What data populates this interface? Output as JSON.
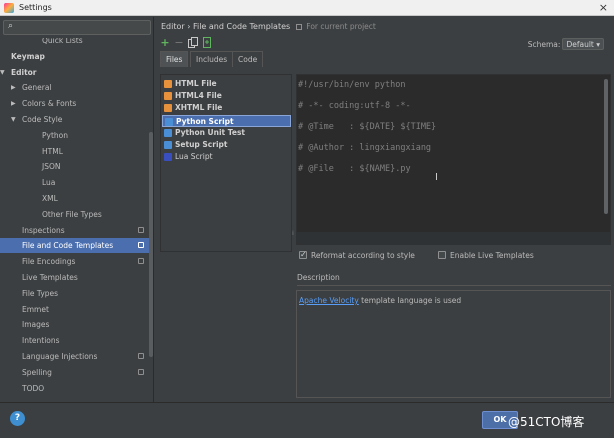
{
  "window": {
    "title": "Settings"
  },
  "sidebar": {
    "search_value": "",
    "items": [
      {
        "label": "Quick Lists",
        "level": 2
      },
      {
        "label": "Keymap",
        "level": 0,
        "bold": true
      },
      {
        "label": "Editor",
        "level": 0,
        "bold": true,
        "expanded": true
      },
      {
        "label": "General",
        "level": 1,
        "arrow": "right"
      },
      {
        "label": "Colors & Fonts",
        "level": 1,
        "arrow": "right"
      },
      {
        "label": "Code Style",
        "level": 1,
        "arrow": "down"
      },
      {
        "label": "Python",
        "level": 2
      },
      {
        "label": "HTML",
        "level": 2
      },
      {
        "label": "JSON",
        "level": 2
      },
      {
        "label": "Lua",
        "level": 2
      },
      {
        "label": "XML",
        "level": 2
      },
      {
        "label": "Other File Types",
        "level": 2
      },
      {
        "label": "Inspections",
        "level": 1,
        "project": true
      },
      {
        "label": "File and Code Templates",
        "level": 1,
        "project": true,
        "selected": true
      },
      {
        "label": "File Encodings",
        "level": 1,
        "project": true
      },
      {
        "label": "Live Templates",
        "level": 1
      },
      {
        "label": "File Types",
        "level": 1
      },
      {
        "label": "Emmet",
        "level": 1
      },
      {
        "label": "Images",
        "level": 1
      },
      {
        "label": "Intentions",
        "level": 1
      },
      {
        "label": "Language Injections",
        "level": 1,
        "project": true
      },
      {
        "label": "Spelling",
        "level": 1,
        "project": true
      },
      {
        "label": "TODO",
        "level": 1
      }
    ]
  },
  "header": {
    "breadcrumb": "Editor › File and Code Templates",
    "scope": "For current project"
  },
  "toolbar": {
    "add_icon": "+",
    "remove_icon": "−",
    "schema_label": "Schema:",
    "schema_value": "Default ▾"
  },
  "tabs": [
    {
      "label": "Files",
      "active": true
    },
    {
      "label": "Includes"
    },
    {
      "label": "Code"
    }
  ],
  "templates": [
    {
      "label": "HTML File",
      "icon_color": "#e8913c"
    },
    {
      "label": "HTML4 File",
      "icon_color": "#e8913c"
    },
    {
      "label": "XHTML File",
      "icon_color": "#e8913c"
    },
    {
      "label": "Python Script",
      "icon_color": "#4a8fd6",
      "selected": true
    },
    {
      "label": "Python Unit Test",
      "icon_color": "#4a8fd6"
    },
    {
      "label": "Setup Script",
      "icon_color": "#4a8fd6"
    },
    {
      "label": "Lua Script",
      "icon_color": "#3a4fbf",
      "normal": true
    }
  ],
  "editor": {
    "lines": [
      "#!/usr/bin/env python",
      "# -*- coding:utf-8 -*-",
      "# @Time   : ${DATE} ${TIME}",
      "# @Author : lingxiangxiang",
      "# @File   : ${NAME}.py"
    ]
  },
  "options": {
    "reformat_label": "Reformat according to style",
    "reformat_checked": true,
    "live_templates_label": "Enable Live Templates",
    "live_templates_checked": false
  },
  "description": {
    "label": "Description",
    "link_text": "Apache Velocity",
    "text": " template language is used"
  },
  "footer": {
    "help_label": "?",
    "ok_label": "OK",
    "watermark": "@51CTO博客"
  }
}
